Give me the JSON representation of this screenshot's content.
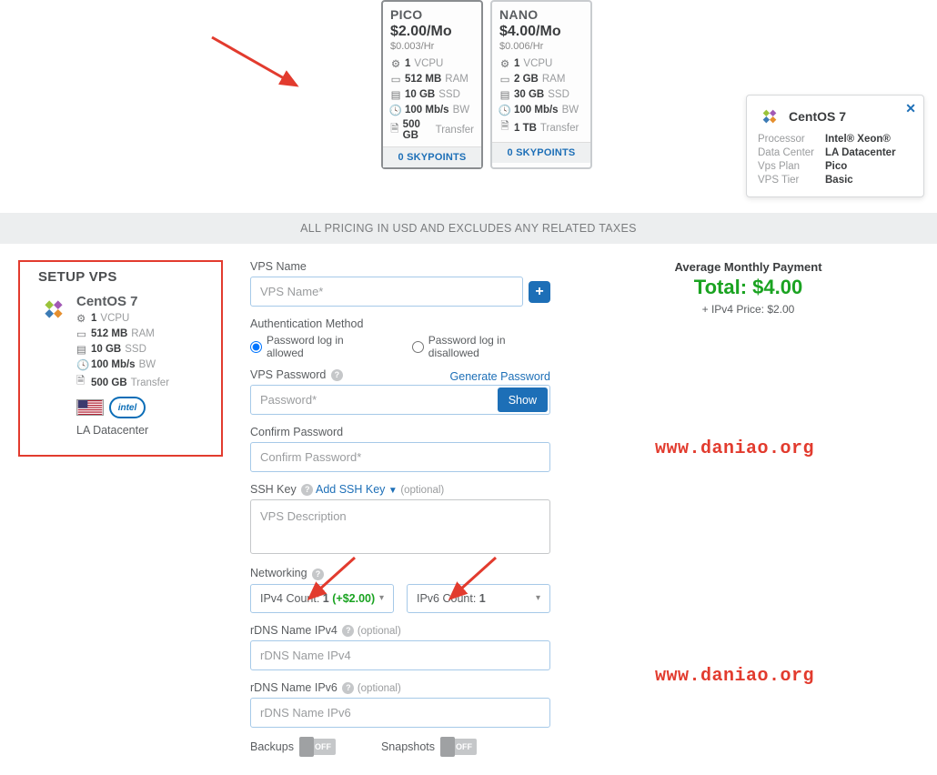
{
  "plans": [
    {
      "name": "PICO",
      "price": "$2.00/Mo",
      "hourly": "$0.003/Hr",
      "vcpu": "1",
      "ram": "512 MB",
      "ssd": "10 GB",
      "bw": "100 Mb/s",
      "transfer": "500 GB",
      "skypoints": "0 SKYPOINTS"
    },
    {
      "name": "NANO",
      "price": "$4.00/Mo",
      "hourly": "$0.006/Hr",
      "vcpu": "1",
      "ram": "2 GB",
      "ssd": "30 GB",
      "bw": "100 Mb/s",
      "transfer": "1 TB",
      "skypoints": "0 SKYPOINTS"
    }
  ],
  "pricing_note": "ALL PRICING IN USD AND EXCLUDES ANY RELATED TAXES",
  "setup": {
    "title": "SETUP VPS",
    "os": "CentOS 7",
    "vcpu": "1",
    "ram": "512 MB",
    "ssd": "10 GB",
    "bw": "100 Mb/s",
    "transfer": "500 GB",
    "intel": "intel",
    "datacenter": "LA Datacenter"
  },
  "form": {
    "vps_name_label": "VPS Name",
    "vps_name_placeholder": "VPS Name*",
    "auth_label": "Authentication Method",
    "auth_allowed": "Password log in allowed",
    "auth_disallowed": "Password log in disallowed",
    "pwd_label": "VPS Password",
    "gen_link": "Generate Password",
    "pwd_placeholder": "Password*",
    "show": "Show",
    "confirm_label": "Confirm Password",
    "confirm_placeholder": "Confirm Password*",
    "ssh_label": "SSH Key",
    "ssh_add": "Add SSH Key",
    "optional": "(optional)",
    "desc_placeholder": "VPS Description",
    "net_label": "Networking",
    "ipv4_prefix": "IPv4 Count: ",
    "ipv4_count": "1",
    "ipv4_price": "(+$2.00)",
    "ipv6_prefix": "IPv6 Count: ",
    "ipv6_count": "1",
    "rdns4_label": "rDNS Name IPv4",
    "rdns4_placeholder": "rDNS Name IPv4",
    "rdns6_label": "rDNS Name IPv6",
    "rdns6_placeholder": "rDNS Name IPv6",
    "backups": "Backups",
    "snapshots": "Snapshots",
    "off": "OFF"
  },
  "summary": {
    "avg": "Average Monthly Payment",
    "total": "Total: $4.00",
    "addon": "+ IPv4 Price: $2.00"
  },
  "popup": {
    "title": "CentOS 7",
    "rows": {
      "proc_k": "Processor",
      "proc_v": "Intel® Xeon®",
      "dc_k": "Data Center",
      "dc_v": "LA Datacenter",
      "plan_k": "Vps Plan",
      "plan_v": "Pico",
      "tier_k": "VPS Tier",
      "tier_v": "Basic"
    }
  },
  "watermark": "www.daniao.org",
  "units": {
    "vcpu": "VCPU",
    "ram": "RAM",
    "ssd": "SSD",
    "bw": "BW",
    "transfer": "Transfer"
  }
}
